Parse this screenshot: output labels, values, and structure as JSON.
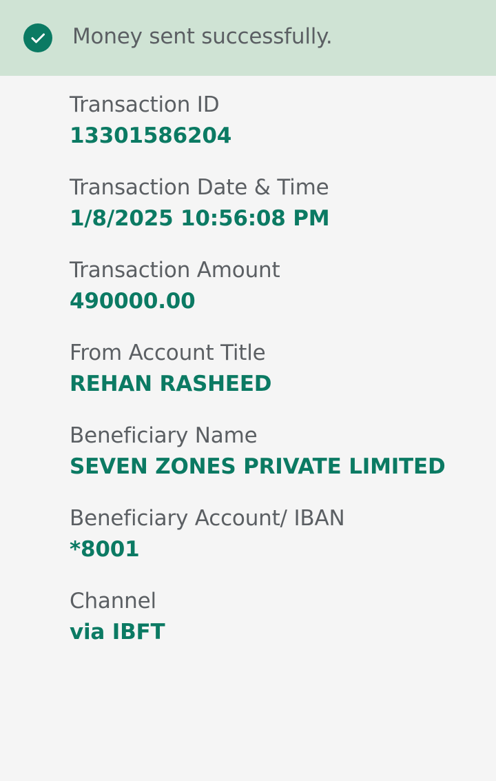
{
  "banner": {
    "icon": "check-circle-icon",
    "message": "Money sent successfully.",
    "background": "#cfe3d4",
    "accent": "#0b7a63"
  },
  "details": [
    {
      "label": "Transaction ID",
      "value": "13301586204"
    },
    {
      "label": "Transaction Date & Time",
      "value": "1/8/2025 10:56:08 PM"
    },
    {
      "label": "Transaction Amount",
      "value": "490000.00"
    },
    {
      "label": "From Account Title",
      "value": "REHAN RASHEED"
    },
    {
      "label": "Beneficiary Name",
      "value": "SEVEN ZONES PRIVATE LIMITED"
    },
    {
      "label": "Beneficiary Account/ IBAN",
      "value": "*8001"
    },
    {
      "label": "Channel",
      "value": "via IBFT"
    }
  ]
}
